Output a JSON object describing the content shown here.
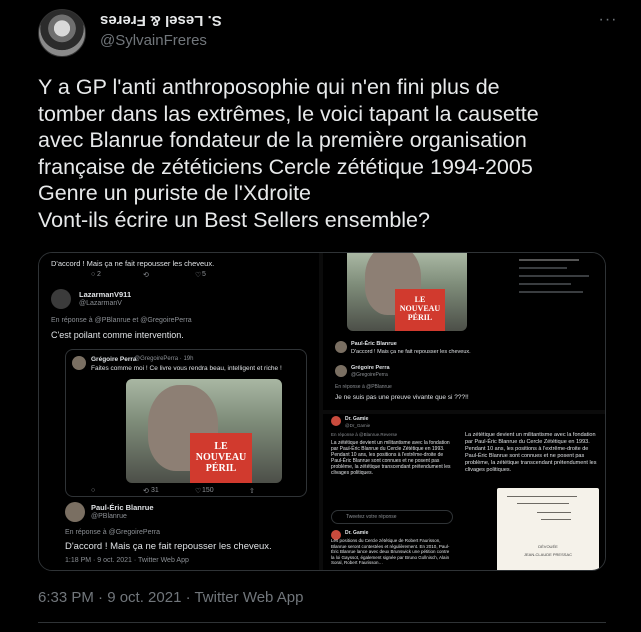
{
  "author": {
    "display_name": "S. Lesel & Freres",
    "handle": "@SylvainFreres"
  },
  "tweet": {
    "text": "Y a GP l'anti anthroposophie qui n'en fini plus de\ntomber dans las extrêmes, le voici tapant la causette\navec Blanrue fondateur de la première organisation\nfrançaise de zététiciens Cercle zététique 1994-2005\nGenre un puriste de l'Xdroite\nVont-ils écrire un Best Sellers ensemble?",
    "timestamp": "6:33 PM · 9 oct. 2021 · Twitter Web App"
  },
  "icons": {
    "more": "more-dots-icon",
    "reply": "reply-icon",
    "retweet": "retweet-icon",
    "like": "heart-icon",
    "share": "share-icon"
  },
  "media": {
    "panel1": {
      "top_reply": "D'accord ! Mais ça ne fait repousser les cheveux.",
      "user1_name": "LazarmanV911",
      "user1_handle": "@LazarmanV",
      "reply_to": "En réponse à @PBlanrue et @GregoirePerra",
      "user1_text": "C'est poilant comme intervention.",
      "quoted_name": "Grégoire Perra",
      "quoted_handle": "@GregoirePerra · 19h",
      "quoted_text": "Faites comme moi ! Ce livre vous rendra beau, intelligent et riche !",
      "book_line1": "LE NOUVEAU",
      "book_line2": "PÉRIL",
      "stat_retweets": "31",
      "stat_likes": "150",
      "reply_author": "Paul-Éric Blanrue",
      "reply_handle": "@PBlanrue",
      "reply_to2": "En réponse à @GregoirePerra",
      "reply_text": "D'accord ! Mais ça ne fait repousser les cheveux.",
      "reply_meta": "1:18 PM · 9 oct. 2021 · Twitter Web App",
      "top_stats_1": "2",
      "top_stats_2": "5"
    },
    "panel2": {
      "author": "Paul-Éric Blanrue",
      "text": "D'accord ! Mais ça ne fait repousser les cheveux.",
      "gp_name": "Grégoire Perra",
      "gp_handle": "@GregoirePerra",
      "gp_reply_to": "En réponse à @PBlanrue",
      "gp_text": "Je ne suis pas une preuve vivante que si ???!!",
      "book_line1": "LE NOUVEAU",
      "book_line2": "PÉRIL"
    },
    "panel3": {
      "name": "Dr. Gamie",
      "handle": "@Dr_Gamie",
      "reply_to": "En réponse à @Blanrue.Reverse",
      "text1": "La zététique devient un militantisme avec la fondation par Paul-Éric Blanrue du Cercle Zététique en 1993. Pendant 10 ans, les positions à l'extrême-droite de Paul-Éric Blanrue sont connues et ne posent pas problème, la zététique transcendant prétendument les clivages politiques.",
      "tweet_reply": "Tweetez votre réponse",
      "second_name": "Dr. Gamie",
      "second_text": "Les positions du Cercle zététique de Robert Faurisson, Blanrue seront contestées et régulièrement. En 2010, Paul-Éric Blanrue lance avec deux Brunswick une pétition contre la loi Gayssot, également signée par Bruno Gollnisch, Alain Soral, Robert Faurisson…",
      "text_right": "La zététique devient un militantisme avec la fondation par Paul-Éric Blanrue du Cercle Zététique en 1993. Pendant 10 ans, les positions à l'extrême-droite de Paul-Éric Blanrue sont connues et ne posent pas problème, la zététique transcendant prétendument les clivages politiques.",
      "letter_line1": "DÉVOUÉE",
      "letter_line2": "JEAN-CLAUDE PRESSAC"
    }
  }
}
